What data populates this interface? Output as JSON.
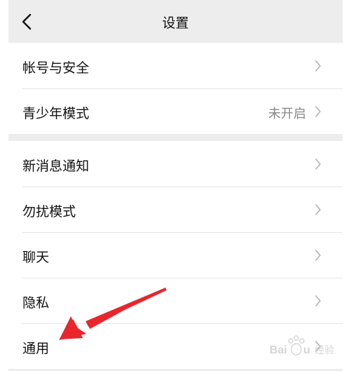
{
  "header": {
    "title": "设置",
    "back_icon": "chevron-left-icon"
  },
  "groups": [
    {
      "items": [
        {
          "label": "帐号与安全",
          "value": ""
        },
        {
          "label": "青少年模式",
          "value": "未开启"
        }
      ]
    },
    {
      "items": [
        {
          "label": "新消息通知",
          "value": ""
        },
        {
          "label": "勿扰模式",
          "value": ""
        },
        {
          "label": "聊天",
          "value": ""
        },
        {
          "label": "隐私",
          "value": ""
        },
        {
          "label": "通用",
          "value": ""
        }
      ]
    }
  ],
  "annotation": {
    "type": "red-arrow",
    "color": "#e8262c"
  },
  "watermark": {
    "brand": "Baidu 经验",
    "icon": "baidu-paw-icon"
  },
  "colors": {
    "nav_background": "#ededed",
    "page_background": "#ededed",
    "cell_background": "#ffffff",
    "divider": "#e5e5e5",
    "secondary_text": "#888888"
  }
}
